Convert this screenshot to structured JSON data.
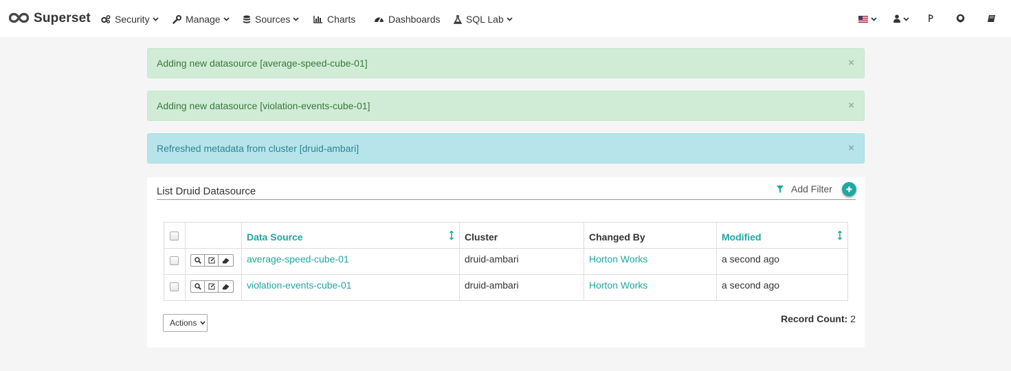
{
  "colors": {
    "accent": "#20a7a0",
    "success_bg": "#d0ecd6",
    "info_bg": "#b6e4ea"
  },
  "navbar": {
    "brand": "Superset",
    "items": [
      {
        "label": "Security",
        "icon": "gears-icon",
        "dropdown": true
      },
      {
        "label": "Manage",
        "icon": "wrench-icon",
        "dropdown": true
      },
      {
        "label": "Sources",
        "icon": "database-icon",
        "dropdown": true
      },
      {
        "label": "Charts",
        "icon": "bar-chart-icon",
        "dropdown": false
      },
      {
        "label": "Dashboards",
        "icon": "dashboard-icon",
        "dropdown": false
      },
      {
        "label": "SQL Lab",
        "icon": "flask-icon",
        "dropdown": true
      }
    ],
    "right": [
      "us-flag-icon",
      "user-icon",
      "version-icon",
      "github-icon",
      "book-icon"
    ]
  },
  "alerts": [
    {
      "type": "success",
      "text": "Adding new datasource [average-speed-cube-01]",
      "close": "×"
    },
    {
      "type": "success",
      "text": "Adding new datasource [violation-events-cube-01]",
      "close": "×"
    },
    {
      "type": "info",
      "text": "Refreshed metadata from cluster [druid-ambari]",
      "close": "×"
    }
  ],
  "list": {
    "title": "List Druid Datasource",
    "add_filter": "Add Filter",
    "columns": [
      "Data Source",
      "Cluster",
      "Changed By",
      "Modified"
    ],
    "rows": [
      {
        "datasource": "average-speed-cube-01",
        "cluster": "druid-ambari",
        "changed_by": "Horton Works",
        "modified": "a second ago"
      },
      {
        "datasource": "violation-events-cube-01",
        "cluster": "druid-ambari",
        "changed_by": "Horton Works",
        "modified": "a second ago"
      }
    ],
    "actions_label": "Actions",
    "record_count_label": "Record Count:",
    "record_count": "2"
  }
}
